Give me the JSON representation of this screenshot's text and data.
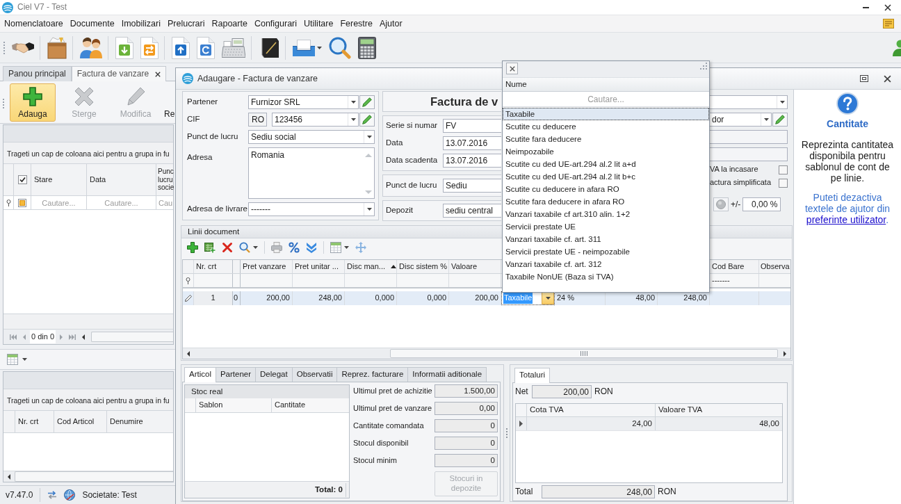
{
  "window": {
    "title": "Ciel V7 - Test"
  },
  "menu": [
    "Nomenclatoare",
    "Documente",
    "Imobilizari",
    "Prelucrari",
    "Rapoarte",
    "Configurari",
    "Utilitare",
    "Ferestre",
    "Ajutor"
  ],
  "doc_tabs": [
    {
      "label": "Panou principal",
      "selected": false
    },
    {
      "label": "Factura de vanzare",
      "selected": true
    }
  ],
  "ribbon": [
    {
      "label": "Adauga",
      "selected": true,
      "disabled": false
    },
    {
      "label": "Sterge",
      "selected": false,
      "disabled": true
    },
    {
      "label": "Modifica",
      "selected": false,
      "disabled": true
    },
    {
      "label": "Re",
      "selected": false,
      "disabled": false
    }
  ],
  "documents_grid": {
    "group_hint": "Trageti un cap de coloana aici pentru a grupa in fu",
    "select_all": {
      "checked": true
    },
    "columns": [
      "Stare",
      "Data",
      "Punc lucru socie"
    ],
    "filters": [
      {
        "placeholder": "Cautare..."
      },
      {
        "placeholder": "Cautare..."
      },
      {
        "placeholder": "Cau"
      }
    ],
    "pager": "0 din 0"
  },
  "detail_grid": {
    "group_hint": "Trageti un cap de coloana aici pentru a grupa in fu",
    "columns": [
      "Nr. crt",
      "Cod Articol",
      "Denumire"
    ]
  },
  "status_bar": {
    "version": "v7.47.0",
    "company": "Societate: Test"
  },
  "dialog": {
    "title": "Adaugare - Factura de vanzare",
    "partner_fields": [
      {
        "kind": "combo_edit",
        "label": "Partener",
        "value": "Furnizor SRL"
      },
      {
        "kind": "combo_edit",
        "label": "CIF",
        "prefix": "RO",
        "value": "123456"
      },
      {
        "kind": "combo",
        "label": "Punct de lucru",
        "value": "Sediu social"
      },
      {
        "kind": "memo",
        "label": "Adresa",
        "value": "Romania"
      },
      {
        "kind": "combo",
        "label": "Adresa de livrare",
        "value": "-------"
      }
    ],
    "heading": "Factura de v",
    "document_fields": [
      {
        "label": "Serie si numar",
        "value": "FV"
      },
      {
        "label": "Data",
        "value": "13.07.2016"
      },
      {
        "label": "Data scadenta",
        "value": "13.07.2016"
      }
    ],
    "location_fields": [
      {
        "label": "Punct de lucru",
        "value": "Sediu"
      },
      {
        "label": "Depozit",
        "value": "sediu central"
      }
    ],
    "side_fields": [
      {
        "kind": "combo"
      },
      {
        "kind": "combo_edit",
        "value": "dor"
      },
      {
        "kind": "text"
      },
      {
        "kind": "text"
      }
    ],
    "options": [
      {
        "label": "VA la incasare",
        "checked": false
      },
      {
        "label": "actura simplificata",
        "checked": false
      }
    ],
    "adjustment": {
      "sign": "+/-",
      "value": "0,00 %"
    },
    "lines": {
      "title": "Linii document",
      "columns": [
        {
          "kind": "index",
          "header": "Nr. crt"
        },
        {
          "kind": "fixed"
        },
        {
          "kind": "number",
          "header": "Pret vanzare"
        },
        {
          "kind": "number",
          "header": "Pret unitar ..."
        },
        {
          "kind": "number",
          "header": "Disc man...",
          "sorted": true
        },
        {
          "kind": "number",
          "header": "Disc sistem %"
        },
        {
          "kind": "number",
          "header": "Valoare"
        },
        {
          "kind": "text"
        },
        {
          "kind": "text"
        },
        {
          "kind": "number"
        },
        {
          "kind": "number"
        },
        {
          "kind": "text",
          "header": "Cod Bare",
          "filter": "-------"
        },
        {
          "header": "Observa"
        }
      ],
      "rows": [
        {
          "selected": true,
          "editing": true,
          "cells": [
            {
              "text": "1",
              "editing": false
            },
            {
              "text": "0",
              "editing": false
            },
            {
              "text": "200,00",
              "editing": false
            },
            {
              "text": "248,00",
              "editing": false
            },
            {
              "text": "0,000",
              "editing": false
            },
            {
              "text": "0,000",
              "editing": false
            },
            {
              "text": "200,00",
              "editing": false
            },
            {
              "text": "Taxabile",
              "editing": true
            },
            {
              "text": "24 %",
              "editing": false
            },
            {
              "text": "48,00",
              "editing": false
            },
            {
              "text": "248,00",
              "editing": false
            }
          ]
        }
      ]
    },
    "article_tabs": [
      {
        "label": "Articol",
        "selected": true
      },
      {
        "label": "Partener",
        "selected": false
      },
      {
        "label": "Delegat",
        "selected": false
      },
      {
        "label": "Observatii",
        "selected": false
      },
      {
        "label": "Reprez. facturare",
        "selected": false
      },
      {
        "label": "Informatii aditionale",
        "selected": false
      }
    ],
    "stock": {
      "title": "Stoc real",
      "columns": [
        "Sablon",
        "Cantitate"
      ],
      "footer": "Total: 0"
    },
    "article_info": [
      {
        "label": "Ultimul pret de achizitie",
        "value": "1.500,00"
      },
      {
        "label": "Ultimul pret de vanzare",
        "value": "0,00"
      },
      {
        "label": "Cantitate comandata",
        "value": "0"
      },
      {
        "label": "Stocul disponibil",
        "value": "0"
      },
      {
        "label": "Stocul minim",
        "value": "0"
      }
    ],
    "stock_button": {
      "label": "Stocuri in depozite",
      "disabled": true
    },
    "totals_tabs": [
      {
        "label": "Totaluri",
        "selected": true
      }
    ],
    "net": {
      "label": "Net",
      "value": "200,00",
      "currency": "RON"
    },
    "vat": {
      "columns": [
        "Cota TVA",
        "Valoare TVA"
      ],
      "rows": [
        [
          "24,00",
          "48,00"
        ]
      ]
    },
    "total": {
      "label": "Total",
      "value": "248,00",
      "currency": "RON"
    },
    "help": {
      "title": "Cantitate",
      "text": "Reprezinta cantitatea disponibila pentru sablonul de cont de pe linie.",
      "note": "Puteti dezactiva textele de ajutor din",
      "link": "preferinte utilizator",
      "note_end": "."
    }
  },
  "dropdown": {
    "header": "Nume",
    "placeholder": "Cautare...",
    "items": [
      {
        "label": "Taxabile",
        "selected": true
      },
      {
        "label": "Scutite cu deducere",
        "selected": false
      },
      {
        "label": "Scutite fara deducere",
        "selected": false
      },
      {
        "label": "Neimpozabile",
        "selected": false
      },
      {
        "label": "Scutite cu ded UE-art.294 al.2 lit a+d",
        "selected": false
      },
      {
        "label": "Scutite cu ded UE-art.294 al.2 lit b+c",
        "selected": false
      },
      {
        "label": "Scutite cu deducere in afara RO",
        "selected": false
      },
      {
        "label": "Scutite fara deducere in afara RO",
        "selected": false
      },
      {
        "label": "Vanzari taxabile cf art.310 alin. 1+2",
        "selected": false
      },
      {
        "label": "Servicii prestate UE",
        "selected": false
      },
      {
        "label": "Vanzari taxabile cf. art. 311",
        "selected": false
      },
      {
        "label": "Servicii prestate UE - neimpozabile",
        "selected": false
      },
      {
        "label": "Vanzari taxabile cf. art. 312",
        "selected": false
      },
      {
        "label": "Taxabile NonUE (Baza si TVA)",
        "selected": false
      }
    ]
  }
}
